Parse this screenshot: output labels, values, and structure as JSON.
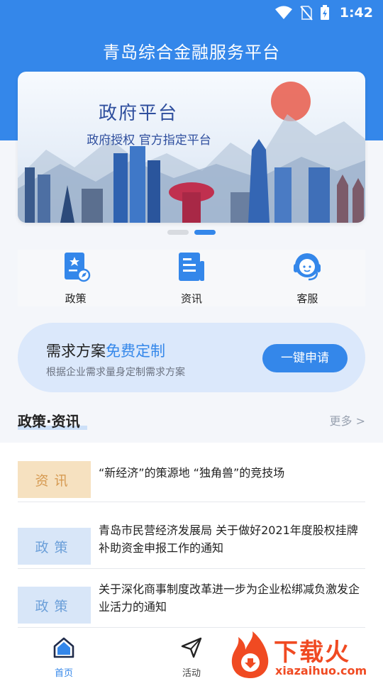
{
  "status_bar": {
    "time": "1:42"
  },
  "header": {
    "title": "青岛综合金融服务平台"
  },
  "banner": {
    "title": "政府平台",
    "subtitle": "政府授权 官方指定平台",
    "pages": 2,
    "active_page": 2
  },
  "quick_menu": [
    {
      "label": "政策",
      "icon": "policy-icon"
    },
    {
      "label": "资讯",
      "icon": "news-icon"
    },
    {
      "label": "客服",
      "icon": "customer-service-icon"
    }
  ],
  "demand_card": {
    "title_plain": "需求方案",
    "title_highlight": "免费定制",
    "description": "根据企业需求量身定制需求方案",
    "button_label": "一键申请"
  },
  "section": {
    "title": "政策·资讯",
    "more_label": "更多 >"
  },
  "news": [
    {
      "tag": "资讯",
      "title": "“新经济”的策源地 “独角兽”的竞技场"
    },
    {
      "tag": "政策",
      "title": "青岛市民营经济发展局 关于做好2021年度股权挂牌补助资金申报工作的通知"
    },
    {
      "tag": "政策",
      "title": "关于深化商事制度改革进一步为企业松绑减负激发企业活力的通知"
    }
  ],
  "bottom_nav": [
    {
      "label": "首页",
      "icon": "home-icon",
      "active": true
    },
    {
      "label": "活动",
      "icon": "send-icon",
      "active": false
    }
  ],
  "watermark": {
    "text": "下载火",
    "url": "xiazaihuo.com"
  },
  "colors": {
    "primary": "#3487ea",
    "highlight": "#3487ea",
    "watermark": "#f04a22"
  }
}
